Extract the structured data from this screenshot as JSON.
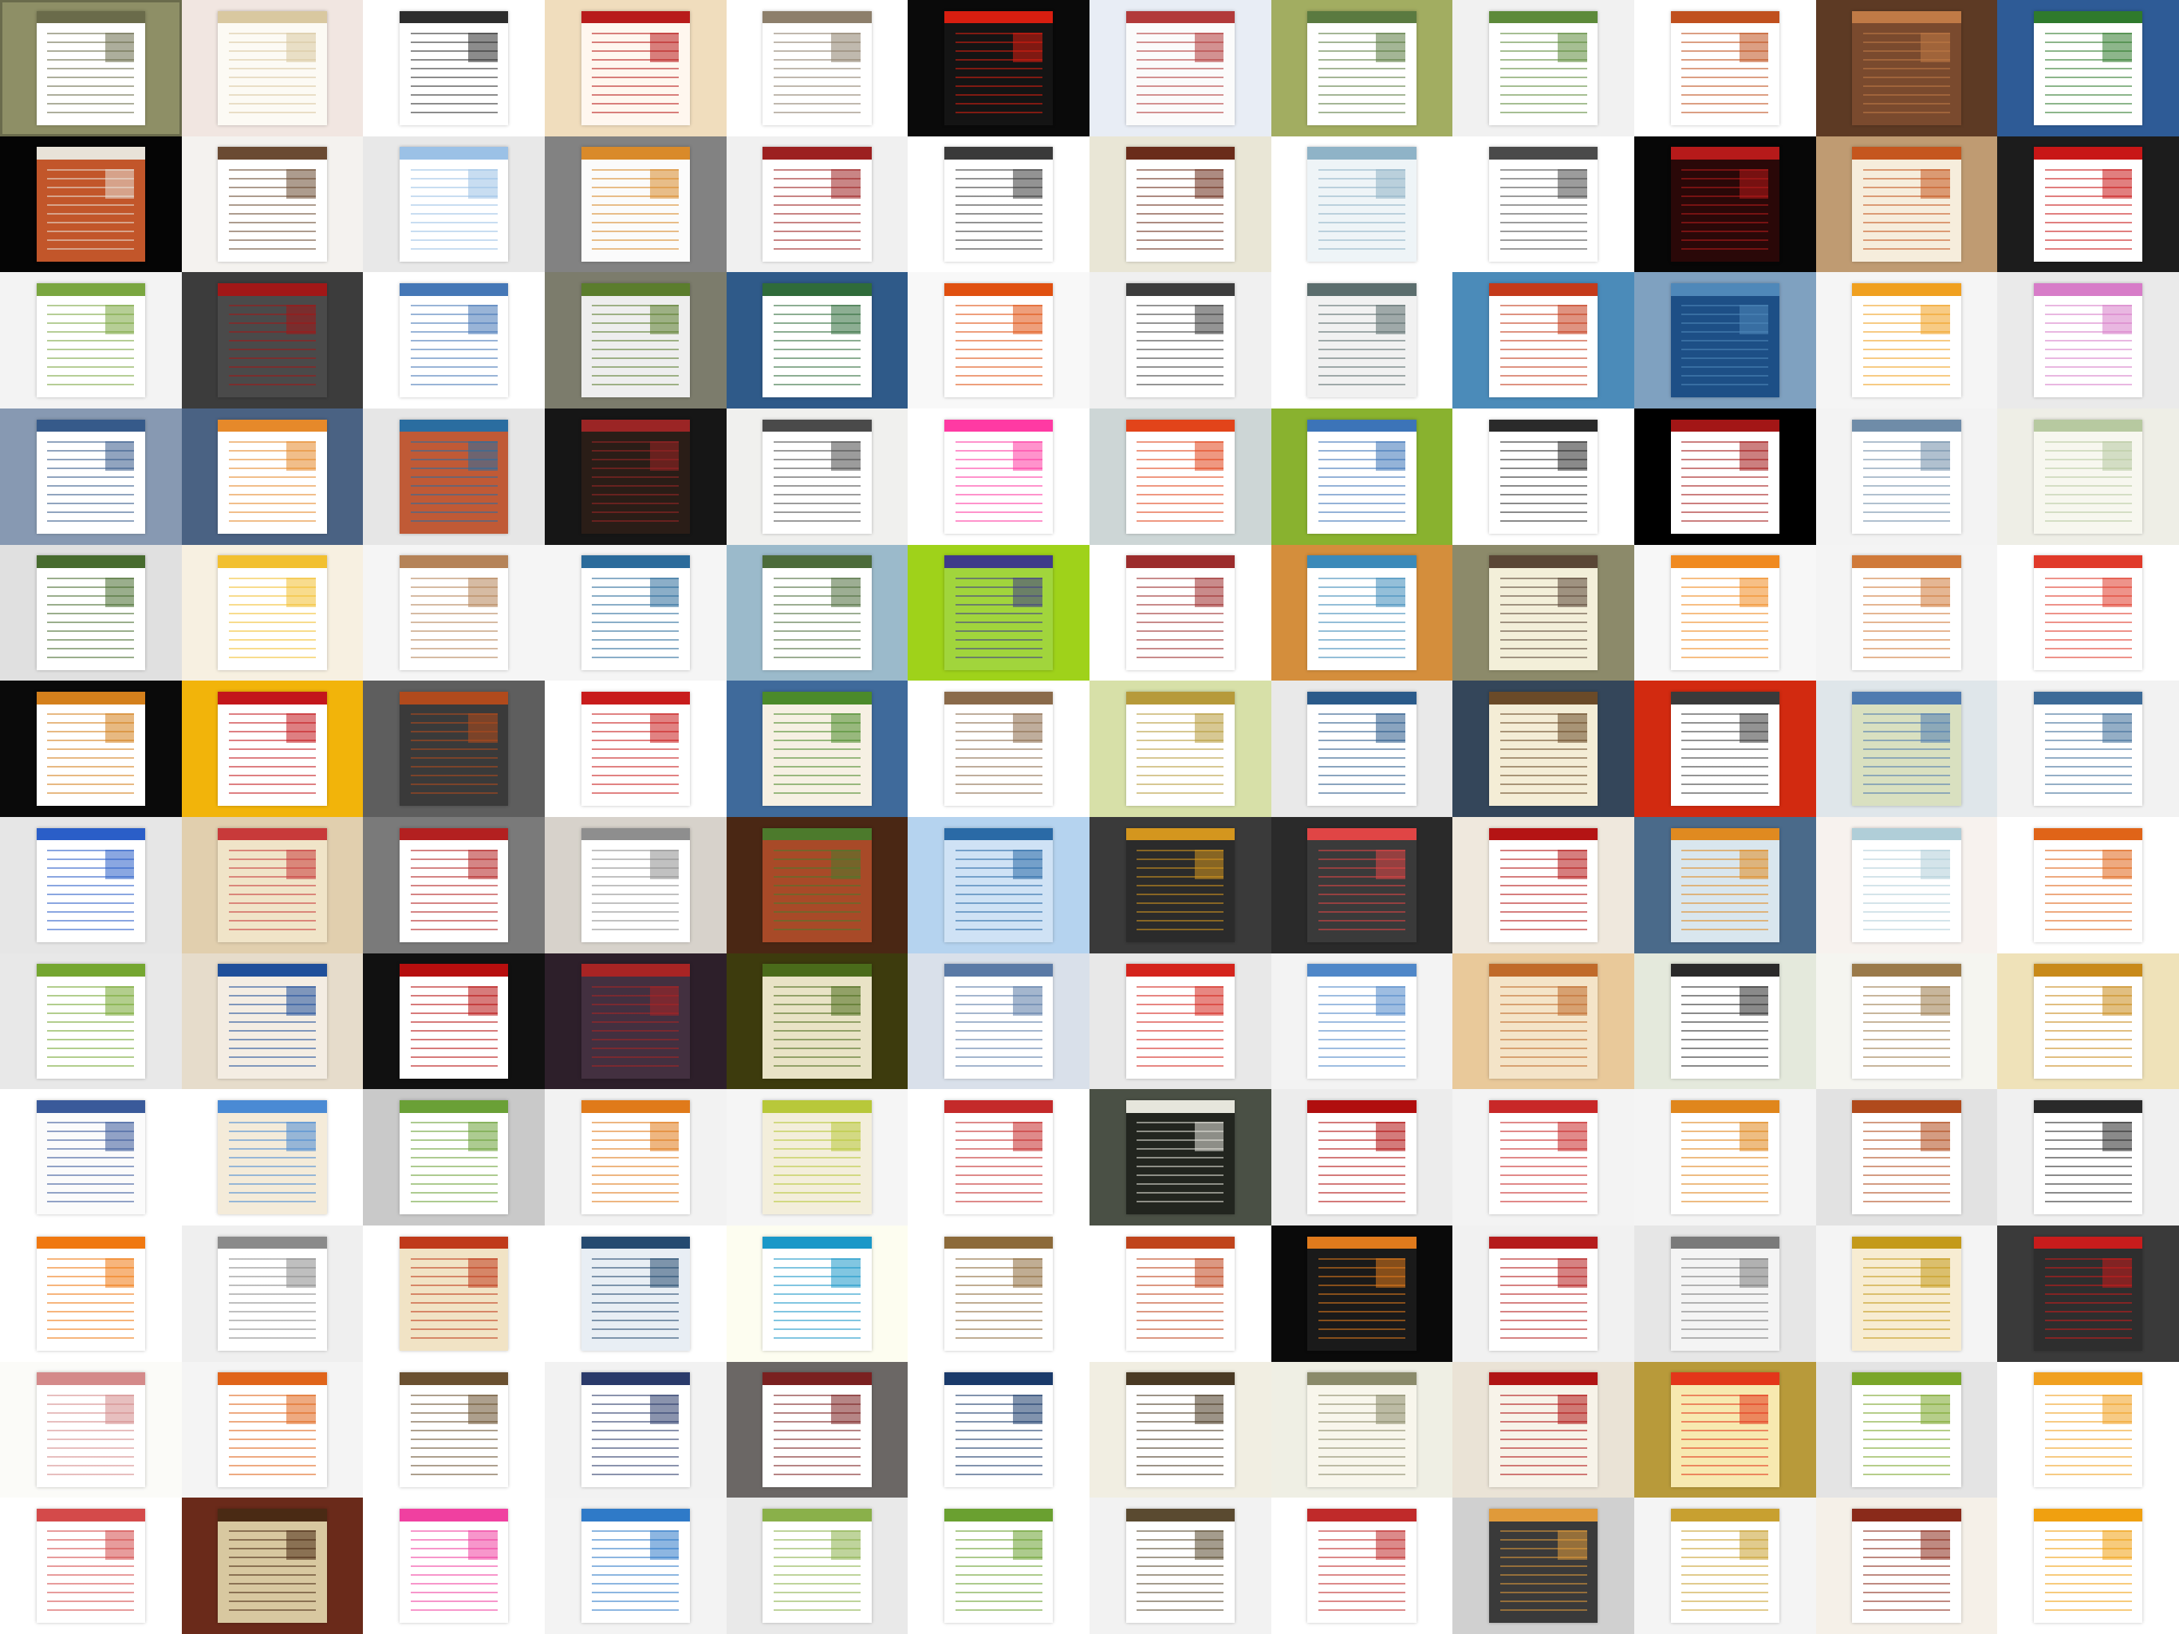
{
  "tiles": [
    {
      "bg": "#8e8f66",
      "page": "#ffffff",
      "accent": "#6a6b4a"
    },
    {
      "bg": "#f1e6e1",
      "page": "#fcfaf4",
      "accent": "#d9c8a0"
    },
    {
      "bg": "#ffffff",
      "page": "#ffffff",
      "accent": "#2d2d2d"
    },
    {
      "bg": "#f0ddbd",
      "page": "#fff7ef",
      "accent": "#b81b1b"
    },
    {
      "bg": "#ffffff",
      "page": "#ffffff",
      "accent": "#8d7f6b"
    },
    {
      "bg": "#0a0a0a",
      "page": "#141414",
      "accent": "#d81e10"
    },
    {
      "bg": "#e8edf5",
      "page": "#fbfbfb",
      "accent": "#b23a3a"
    },
    {
      "bg": "#a2ad61",
      "page": "#ffffff",
      "accent": "#5a7a40"
    },
    {
      "bg": "#f1f1f1",
      "page": "#ffffff",
      "accent": "#5d8a3a"
    },
    {
      "bg": "#ffffff",
      "page": "#ffffff",
      "accent": "#c0501e"
    },
    {
      "bg": "#5d3a24",
      "page": "#7a4a2e",
      "accent": "#c07a46"
    },
    {
      "bg": "#2e5b96",
      "page": "#ffffff",
      "accent": "#2f7a2c"
    },
    {
      "bg": "#050505",
      "page": "#c2562a",
      "accent": "#e8e2d8"
    },
    {
      "bg": "#f4f2ef",
      "page": "#ffffff",
      "accent": "#6a4a32"
    },
    {
      "bg": "#e8e8e8",
      "page": "#ffffff",
      "accent": "#9bc1e6"
    },
    {
      "bg": "#828282",
      "page": "#fbfbfb",
      "accent": "#d98a2a"
    },
    {
      "bg": "#f0f0f0",
      "page": "#ffffff",
      "accent": "#9c2020"
    },
    {
      "bg": "#ffffff",
      "page": "#ffffff",
      "accent": "#3a3a3a"
    },
    {
      "bg": "#e9e6d6",
      "page": "#ffffff",
      "accent": "#6a2c1a"
    },
    {
      "bg": "#ffffff",
      "page": "#eef4f7",
      "accent": "#8fb3c7"
    },
    {
      "bg": "#ffffff",
      "page": "#ffffff",
      "accent": "#4a4a4a"
    },
    {
      "bg": "#070707",
      "page": "#2a0808",
      "accent": "#b61a1a"
    },
    {
      "bg": "#bf9b72",
      "page": "#f6eddc",
      "accent": "#c5561e"
    },
    {
      "bg": "#1c1c1c",
      "page": "#ffffff",
      "accent": "#c81616"
    },
    {
      "bg": "#f3f3f3",
      "page": "#ffffff",
      "accent": "#7aa640"
    },
    {
      "bg": "#3c3c3c",
      "page": "#4a4a4a",
      "accent": "#a11717"
    },
    {
      "bg": "#ffffff",
      "page": "#ffffff",
      "accent": "#4577b6"
    },
    {
      "bg": "#7c7c6c",
      "page": "#eeeeee",
      "accent": "#5b7d2d"
    },
    {
      "bg": "#2f5a89",
      "page": "#ffffff",
      "accent": "#2f6b3a"
    },
    {
      "bg": "#f8f8f8",
      "page": "#ffffff",
      "accent": "#e05010"
    },
    {
      "bg": "#f0f0f0",
      "page": "#ffffff",
      "accent": "#3d3d3d"
    },
    {
      "bg": "#ffffff",
      "page": "#f1f1f1",
      "accent": "#5b6d6d"
    },
    {
      "bg": "#4b8bb9",
      "page": "#ffffff",
      "accent": "#c43a1a"
    },
    {
      "bg": "#7fa1c0",
      "page": "#1d4f86",
      "accent": "#4f88b9"
    },
    {
      "bg": "#f5f5f5",
      "page": "#ffffff",
      "accent": "#f0a020"
    },
    {
      "bg": "#eaeaea",
      "page": "#ffffff",
      "accent": "#d77cc8"
    },
    {
      "bg": "#8799b2",
      "page": "#ffffff",
      "accent": "#365a8a"
    },
    {
      "bg": "#4a6283",
      "page": "#ffffff",
      "accent": "#e6892a"
    },
    {
      "bg": "#e6e6e6",
      "page": "#c05a36",
      "accent": "#2a6da0"
    },
    {
      "bg": "#161616",
      "page": "#2a1d17",
      "accent": "#9b2525"
    },
    {
      "bg": "#f0f0ee",
      "page": "#ffffff",
      "accent": "#4a4a4a"
    },
    {
      "bg": "#ffffff",
      "page": "#ffffff",
      "accent": "#ff3aa3"
    },
    {
      "bg": "#cdd6d6",
      "page": "#ffffff",
      "accent": "#e2441a"
    },
    {
      "bg": "#89b22f",
      "page": "#ffffff",
      "accent": "#3c74b8"
    },
    {
      "bg": "#ffffff",
      "page": "#ffffff",
      "accent": "#2a2a2a"
    },
    {
      "bg": "#000000",
      "page": "#ffffff",
      "accent": "#a31616"
    },
    {
      "bg": "#f3f3f3",
      "page": "#ffffff",
      "accent": "#6f8ca8"
    },
    {
      "bg": "#eeeee6",
      "page": "#f7f7ef",
      "accent": "#b7c9a0"
    },
    {
      "bg": "#e0e0e0",
      "page": "#ffffff",
      "accent": "#476b2e"
    },
    {
      "bg": "#f7f0e1",
      "page": "#ffffff",
      "accent": "#f2c030"
    },
    {
      "bg": "#f5f5f5",
      "page": "#ffffff",
      "accent": "#b58358"
    },
    {
      "bg": "#f5f5f5",
      "page": "#ffffff",
      "accent": "#2b6b9b"
    },
    {
      "bg": "#9bbacb",
      "page": "#ffffff",
      "accent": "#4c6b3a"
    },
    {
      "bg": "#9fd21a",
      "page": "#a1d53c",
      "accent": "#3f3a8a"
    },
    {
      "bg": "#ffffff",
      "page": "#ffffff",
      "accent": "#9c2c2c"
    },
    {
      "bg": "#d48e3c",
      "page": "#ffffff",
      "accent": "#3c8ab9"
    },
    {
      "bg": "#8c8a6a",
      "page": "#f3efd9",
      "accent": "#5a4636"
    },
    {
      "bg": "#f7f7f7",
      "page": "#ffffff",
      "accent": "#f08a20"
    },
    {
      "bg": "#f4f4f4",
      "page": "#ffffff",
      "accent": "#d07a3a"
    },
    {
      "bg": "#ffffff",
      "page": "#ffffff",
      "accent": "#e03a2a"
    },
    {
      "bg": "#0a0a0a",
      "page": "#ffffff",
      "accent": "#d4801c"
    },
    {
      "bg": "#f2b40a",
      "page": "#ffffff",
      "accent": "#c3161b"
    },
    {
      "bg": "#5e5e5e",
      "page": "#3a3a3a",
      "accent": "#b14a1c"
    },
    {
      "bg": "#ffffff",
      "page": "#ffffff",
      "accent": "#c81c1c"
    },
    {
      "bg": "#3f6a9b",
      "page": "#f6f0e3",
      "accent": "#4b8a2a"
    },
    {
      "bg": "#ffffff",
      "page": "#ffffff",
      "accent": "#8a6a4a"
    },
    {
      "bg": "#d7e0a8",
      "page": "#ffffff",
      "accent": "#b69a3a"
    },
    {
      "bg": "#e9e9e9",
      "page": "#ffffff",
      "accent": "#2a5a8a"
    },
    {
      "bg": "#34465a",
      "page": "#f4edd6",
      "accent": "#6a4a28"
    },
    {
      "bg": "#d22a10",
      "page": "#ffffff",
      "accent": "#3a3a3a"
    },
    {
      "bg": "#dfe6ea",
      "page": "#d9e0c0",
      "accent": "#4f7bb0"
    },
    {
      "bg": "#f2f2f2",
      "page": "#ffffff",
      "accent": "#3d6b98"
    },
    {
      "bg": "#e6e6e6",
      "page": "#ffffff",
      "accent": "#2a5ec8"
    },
    {
      "bg": "#e1cfae",
      "page": "#f0e4c8",
      "accent": "#c83a3a"
    },
    {
      "bg": "#7a7a7a",
      "page": "#ffffff",
      "accent": "#b32020"
    },
    {
      "bg": "#d7d2cb",
      "page": "#ffffff",
      "accent": "#8e8e8e"
    },
    {
      "bg": "#4a2714",
      "page": "#a84a28",
      "accent": "#4c7a2c"
    },
    {
      "bg": "#b5d3ef",
      "page": "#cfe2f5",
      "accent": "#2a6aa6"
    },
    {
      "bg": "#3a3a3a",
      "page": "#2b2b2b",
      "accent": "#d4961e"
    },
    {
      "bg": "#2a2a2a",
      "page": "#3a3a3a",
      "accent": "#e04545"
    },
    {
      "bg": "#efe8dd",
      "page": "#ffffff",
      "accent": "#b41414"
    },
    {
      "bg": "#4a6a8a",
      "page": "#d9e6ee",
      "accent": "#e08a20"
    },
    {
      "bg": "#f7f2ee",
      "page": "#ffffff",
      "accent": "#b0ced8"
    },
    {
      "bg": "#ffffff",
      "page": "#ffffff",
      "accent": "#e06418"
    },
    {
      "bg": "#e8e8e8",
      "page": "#ffffff",
      "accent": "#74a630"
    },
    {
      "bg": "#e6dccb",
      "page": "#f4ede3",
      "accent": "#1f4f9a"
    },
    {
      "bg": "#111111",
      "page": "#ffffff",
      "accent": "#b60e0e"
    },
    {
      "bg": "#2d1f2a",
      "page": "#433040",
      "accent": "#a82424"
    },
    {
      "bg": "#3d3b0d",
      "page": "#e9e3c6",
      "accent": "#4a6b1a"
    },
    {
      "bg": "#d9e0ea",
      "page": "#ffffff",
      "accent": "#5a7aa6"
    },
    {
      "bg": "#e8e8e8",
      "page": "#ffffff",
      "accent": "#d4241c"
    },
    {
      "bg": "#f3f3f3",
      "page": "#ffffff",
      "accent": "#4f87c8"
    },
    {
      "bg": "#e9c99a",
      "page": "#f4e4c8",
      "accent": "#c06a2a"
    },
    {
      "bg": "#e4e9dc",
      "page": "#ffffff",
      "accent": "#2a2a2a"
    },
    {
      "bg": "#f5f5f0",
      "page": "#ffffff",
      "accent": "#9a7a4a"
    },
    {
      "bg": "#efe2b9",
      "page": "#ffffff",
      "accent": "#c88a1a"
    },
    {
      "bg": "#ffffff",
      "page": "#fbfbfb",
      "accent": "#3a5a9a"
    },
    {
      "bg": "#ffffff",
      "page": "#f4ebd9",
      "accent": "#4a8ad4"
    },
    {
      "bg": "#c9c9c9",
      "page": "#ffffff",
      "accent": "#6aa036"
    },
    {
      "bg": "#f2f2f2",
      "page": "#ffffff",
      "accent": "#e07a1a"
    },
    {
      "bg": "#f5f5f5",
      "page": "#f3eedb",
      "accent": "#b8c83a"
    },
    {
      "bg": "#ffffff",
      "page": "#ffffff",
      "accent": "#c42a2a"
    },
    {
      "bg": "#4a5045",
      "page": "#22251f",
      "accent": "#e6e6dc"
    },
    {
      "bg": "#ececec",
      "page": "#ffffff",
      "accent": "#b00e0e"
    },
    {
      "bg": "#f3f3f3",
      "page": "#ffffff",
      "accent": "#c82828"
    },
    {
      "bg": "#f4f4f4",
      "page": "#ffffff",
      "accent": "#e0861c"
    },
    {
      "bg": "#e2e2e2",
      "page": "#ffffff",
      "accent": "#b04a1c"
    },
    {
      "bg": "#f0f0f0",
      "page": "#ffffff",
      "accent": "#2a2a2a"
    },
    {
      "bg": "#ffffff",
      "page": "#ffffff",
      "accent": "#f07810"
    },
    {
      "bg": "#efefef",
      "page": "#ffffff",
      "accent": "#8a8a8a"
    },
    {
      "bg": "#ffffff",
      "page": "#f1e3c5",
      "accent": "#c03a1a"
    },
    {
      "bg": "#ffffff",
      "page": "#e8eef4",
      "accent": "#254a70"
    },
    {
      "bg": "#fdfdf0",
      "page": "#ffffff",
      "accent": "#1a98c8"
    },
    {
      "bg": "#ffffff",
      "page": "#ffffff",
      "accent": "#8c6a3a"
    },
    {
      "bg": "#ffffff",
      "page": "#ffffff",
      "accent": "#c0441c"
    },
    {
      "bg": "#0a0a0a",
      "page": "#1a1a1a",
      "accent": "#e07a1c"
    },
    {
      "bg": "#f1f1f1",
      "page": "#ffffff",
      "accent": "#b51c1c"
    },
    {
      "bg": "#e6e6e6",
      "page": "#f4f4f4",
      "accent": "#7a7a7a"
    },
    {
      "bg": "#f4f4f4",
      "page": "#f7ecd2",
      "accent": "#c49a1a"
    },
    {
      "bg": "#3a3a3a",
      "page": "#2e2e2e",
      "accent": "#c81c1c"
    },
    {
      "bg": "#fbfbf8",
      "page": "#ffffff",
      "accent": "#d48a8a"
    },
    {
      "bg": "#f4f4f4",
      "page": "#ffffff",
      "accent": "#e0641a"
    },
    {
      "bg": "#ffffff",
      "page": "#ffffff",
      "accent": "#6a5030"
    },
    {
      "bg": "#f2f2f2",
      "page": "#ffffff",
      "accent": "#2a3a6a"
    },
    {
      "bg": "#6b6765",
      "page": "#ffffff",
      "accent": "#7a2020"
    },
    {
      "bg": "#ffffff",
      "page": "#ffffff",
      "accent": "#1a3a6a"
    },
    {
      "bg": "#f1eee2",
      "page": "#ffffff",
      "accent": "#4a3a24"
    },
    {
      "bg": "#efefe4",
      "page": "#f8f6ec",
      "accent": "#8a8a6a"
    },
    {
      "bg": "#eae3d6",
      "page": "#f7f3e9",
      "accent": "#b01414"
    },
    {
      "bg": "#b89a3a",
      "page": "#f7e9b0",
      "accent": "#e3361a"
    },
    {
      "bg": "#e4e4e4",
      "page": "#ffffff",
      "accent": "#7aa62a"
    },
    {
      "bg": "#ffffff",
      "page": "#ffffff",
      "accent": "#f0a020"
    },
    {
      "bg": "#ffffff",
      "page": "#ffffff",
      "accent": "#d44a4a"
    },
    {
      "bg": "#6a2a1a",
      "page": "#d8c8a0",
      "accent": "#4a2a14"
    },
    {
      "bg": "#ffffff",
      "page": "#ffffff",
      "accent": "#f040a0"
    },
    {
      "bg": "#f3f3f3",
      "page": "#ffffff",
      "accent": "#2f7ac8"
    },
    {
      "bg": "#e9e9e9",
      "page": "#ffffff",
      "accent": "#8ab04a"
    },
    {
      "bg": "#ffffff",
      "page": "#ffffff",
      "accent": "#6aa030"
    },
    {
      "bg": "#f2f2f2",
      "page": "#ffffff",
      "accent": "#5a4a30"
    },
    {
      "bg": "#ffffff",
      "page": "#ffffff",
      "accent": "#c02a2a"
    },
    {
      "bg": "#d0d0d0",
      "page": "#3a3a3a",
      "accent": "#e09a3a"
    },
    {
      "bg": "#f4f4f4",
      "page": "#ffffff",
      "accent": "#c8a030"
    },
    {
      "bg": "#f5f0e8",
      "page": "#ffffff",
      "accent": "#8a2a1a"
    },
    {
      "bg": "#ffffff",
      "page": "#ffffff",
      "accent": "#f0a010"
    }
  ]
}
